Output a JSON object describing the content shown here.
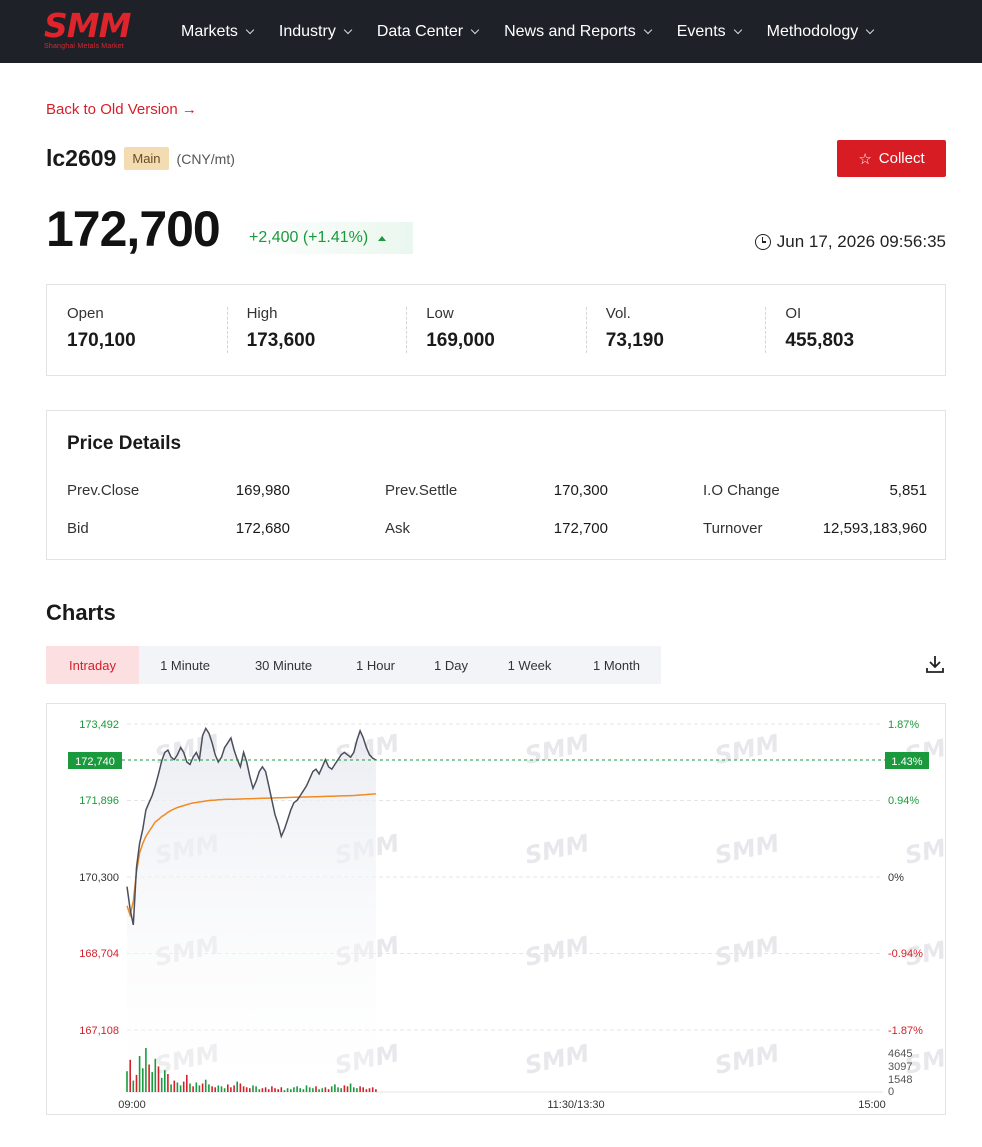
{
  "nav": {
    "logo_text": "SMM",
    "logo_subtitle": "Shanghai Metals Market",
    "items": [
      {
        "label": "Markets"
      },
      {
        "label": "Industry"
      },
      {
        "label": "Data Center"
      },
      {
        "label": "News and Reports"
      },
      {
        "label": "Events"
      },
      {
        "label": "Methodology"
      }
    ]
  },
  "back_link": "Back to Old Version →",
  "instrument": {
    "symbol": "lc2609",
    "badge": "Main",
    "unit": "(CNY/mt)"
  },
  "collect_label": "Collect",
  "price": {
    "last": "172,700",
    "change": "+2,400 (+1.41%)",
    "timestamp": "Jun 17, 2026 09:56:35"
  },
  "stats": [
    {
      "label": "Open",
      "value": "170,100"
    },
    {
      "label": "High",
      "value": "173,600"
    },
    {
      "label": "Low",
      "value": "169,000"
    },
    {
      "label": "Vol.",
      "value": "73,190"
    },
    {
      "label": "OI",
      "value": "455,803"
    }
  ],
  "details": {
    "title": "Price Details",
    "rows": [
      [
        {
          "label": "Prev.Close",
          "value": "169,980"
        },
        {
          "label": "Prev.Settle",
          "value": "170,300"
        },
        {
          "label": "I.O Change",
          "value": "5,851"
        }
      ],
      [
        {
          "label": "Bid",
          "value": "172,680"
        },
        {
          "label": "Ask",
          "value": "172,700"
        },
        {
          "label": "Turnover",
          "value": "12,593,183,960"
        }
      ]
    ]
  },
  "charts": {
    "title": "Charts",
    "tabs": [
      {
        "label": "Intraday",
        "active": true
      },
      {
        "label": "1 Minute"
      },
      {
        "label": "30 Minute"
      },
      {
        "label": "1 Hour"
      },
      {
        "label": "1 Day"
      },
      {
        "label": "1 Week"
      },
      {
        "label": "1 Month"
      }
    ]
  },
  "colors": {
    "brand_red": "#d71c24",
    "up_green": "#1a9a3c",
    "down_red": "#d4202a",
    "nav_bg": "#1f2129",
    "price_line": "#4a4f5c",
    "avg_line": "#f08a24"
  },
  "icons": {
    "collect": "star-icon",
    "timestamp": "clock-icon",
    "download": "download-icon",
    "change": "triangle-up-icon"
  },
  "chart_data": {
    "type": "line",
    "ylim": [
      167108,
      173492
    ],
    "y_ticks_left": [
      "173,492",
      "171,896",
      "170,300",
      "168,704",
      "167,108"
    ],
    "y_ticks_right": [
      "1.87%",
      "0.94%",
      "0%",
      "-0.94%",
      "-1.87%"
    ],
    "current_price_label": "172,740",
    "current_pct_label": "1.43%",
    "current_value": 172740,
    "x_ticks": [
      "09:00",
      "11:30/13:30",
      "15:00"
    ],
    "volume_ticks": [
      "4645",
      "3097",
      "1548",
      "0"
    ],
    "volume_max": 4645,
    "series": [
      {
        "type": "price",
        "values": [
          170100,
          169620,
          169300,
          170500,
          171000,
          171300,
          171700,
          171850,
          172000,
          172200,
          172450,
          172720,
          172900,
          172950,
          172800,
          172750,
          172850,
          173000,
          172900,
          172700,
          172650,
          172800,
          172900,
          172750,
          173250,
          173400,
          173300,
          173100,
          172850,
          172700,
          172800,
          173000,
          173100,
          173200,
          172950,
          172750,
          172600,
          172900,
          172700,
          172400,
          172150,
          172300,
          172500,
          172600,
          172500,
          172200,
          171900,
          171600,
          171400,
          171150,
          171300,
          171500,
          171700,
          171850,
          171900,
          172000,
          172100,
          172200,
          172350,
          172500,
          172550,
          172450,
          172600,
          172750,
          172600,
          172550,
          172650,
          172750,
          172850,
          172900,
          172850,
          172800,
          172900,
          173150,
          173350,
          173200,
          173000,
          172850,
          172780,
          172740
        ]
      },
      {
        "type": "average",
        "values": [
          169700,
          169500,
          169800,
          170400,
          170800,
          171000,
          171150,
          171250,
          171350,
          171450,
          171500,
          171560,
          171600,
          171650,
          171690,
          171720,
          171750,
          171770,
          171790,
          171810,
          171830,
          171845,
          171855,
          171865,
          171875,
          171885,
          171895,
          171900,
          171905,
          171910,
          171915,
          171918,
          171920,
          171922,
          171924,
          171926,
          171928,
          171930,
          171932,
          171934,
          171936,
          171938,
          171940,
          171942,
          171944,
          171946,
          171948,
          171950,
          171952,
          171954,
          171956,
          171958,
          171960,
          171962,
          171964,
          171966,
          171968,
          171970,
          171972,
          171974,
          171976,
          171978,
          171980,
          171982,
          171984,
          171986,
          171988,
          171990,
          171992,
          171994,
          171996,
          171998,
          172000,
          172005,
          172010,
          172015,
          172020,
          172025,
          172030,
          172035
        ]
      }
    ],
    "volume": [
      2200,
      3400,
      1200,
      1800,
      3800,
      2500,
      4645,
      2900,
      2100,
      3500,
      2700,
      1500,
      2300,
      1900,
      800,
      1200,
      1000,
      700,
      1100,
      1800,
      900,
      600,
      1000,
      700,
      900,
      1300,
      800,
      600,
      500,
      700,
      600,
      400,
      800,
      500,
      700,
      1100,
      900,
      600,
      500,
      400,
      700,
      600,
      300,
      400,
      500,
      300,
      600,
      400,
      300,
      500,
      200,
      400,
      300,
      500,
      600,
      400,
      300,
      700,
      500,
      400,
      600,
      300,
      400,
      500,
      300,
      600,
      800,
      500,
      400,
      700,
      600,
      900,
      500,
      400,
      600,
      500,
      300,
      400,
      500,
      300
    ],
    "volume_up": [
      true,
      false,
      true,
      false,
      true,
      true,
      true,
      false,
      true,
      true,
      false,
      true,
      true,
      false,
      true,
      false,
      true,
      true,
      false,
      false,
      true,
      false,
      true,
      true,
      false,
      true,
      true,
      false,
      false,
      true,
      true,
      true,
      false,
      false,
      false,
      true,
      false,
      false,
      false,
      false,
      true,
      true,
      true,
      false,
      false,
      false,
      false,
      false,
      false,
      false,
      true,
      true,
      true,
      true,
      true,
      true,
      true,
      true,
      true,
      true,
      false,
      true,
      true,
      false,
      false,
      true,
      true,
      true,
      true,
      false,
      false,
      true,
      true,
      true,
      false,
      false,
      false,
      false,
      false,
      false
    ]
  }
}
